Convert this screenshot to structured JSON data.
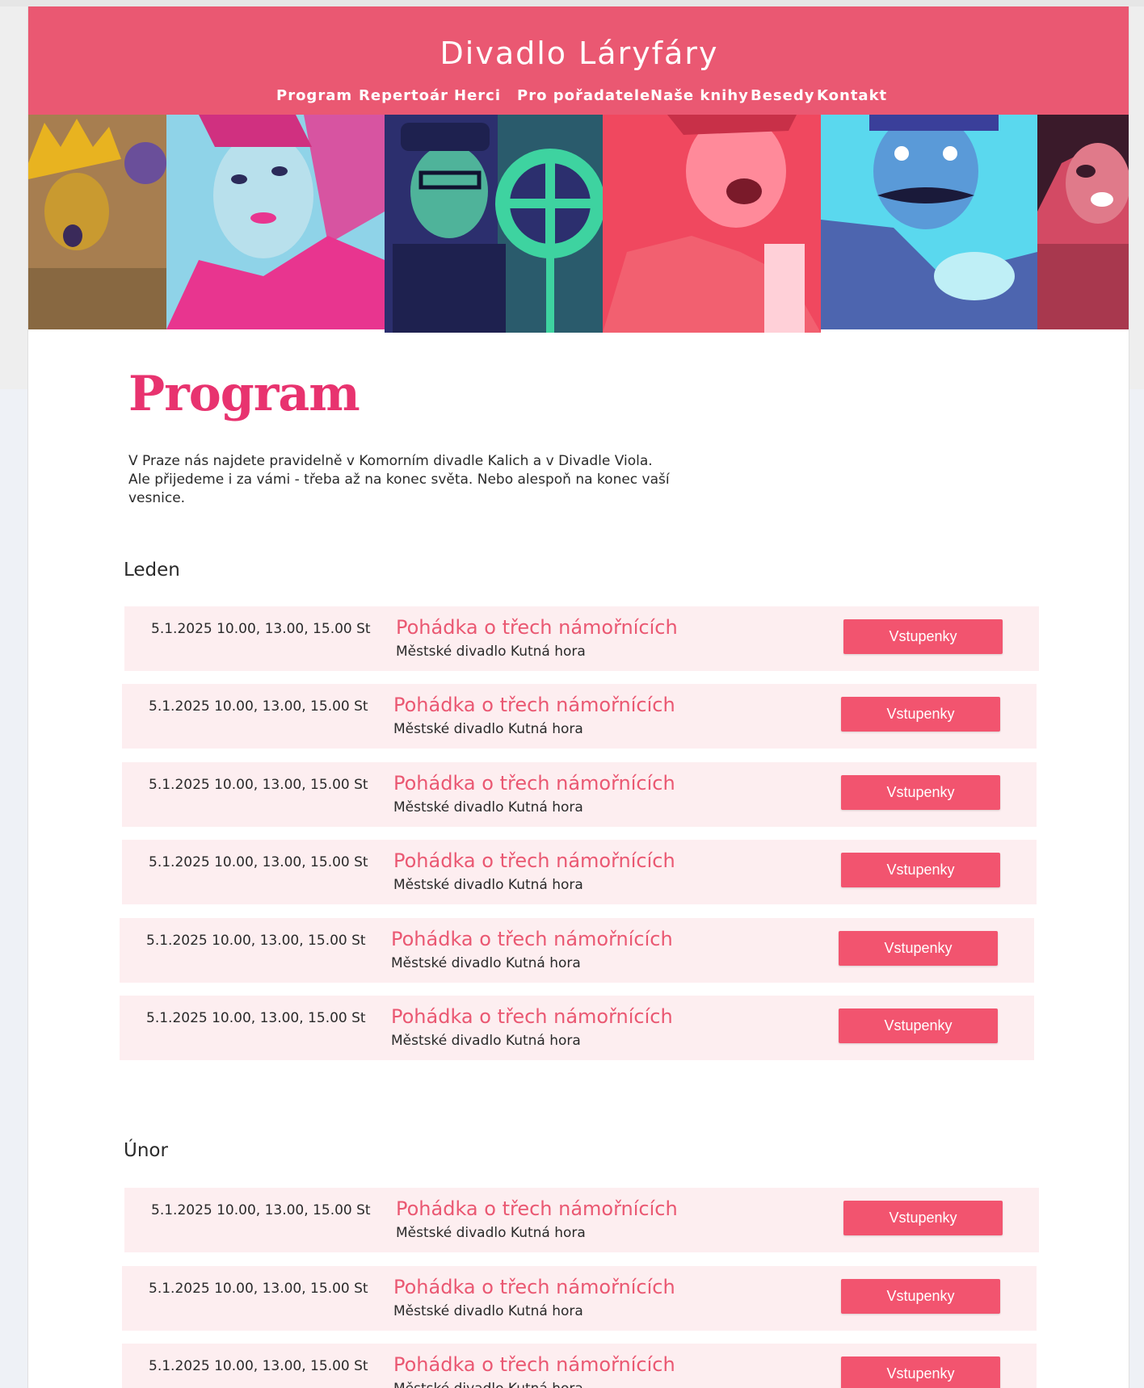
{
  "site": {
    "title": "Divadlo Láryfáry"
  },
  "nav": {
    "items": [
      {
        "label": "Program"
      },
      {
        "label": "Repertoár"
      },
      {
        "label": "Herci"
      },
      {
        "label": "Pro pořadatele"
      },
      {
        "label": "Naše knihy"
      },
      {
        "label": "Besedy"
      },
      {
        "label": "Kontakt"
      }
    ]
  },
  "colors": {
    "header": "#ea5872",
    "accent": "#e8336f",
    "row_background": "#fdeef0",
    "button": "#f2546f"
  },
  "banner": {
    "photos": [
      {
        "tint": "#e8b320",
        "shade": "#5a3f8a",
        "subject": "native-costume-actress"
      },
      {
        "tint": "#e8358f",
        "shade": "#8fd3e8",
        "subject": "clown-makeup-actress"
      },
      {
        "tint": "#3ed3a0",
        "shade": "#2c2f6e",
        "subject": "conductor-with-whistle"
      },
      {
        "tint": "#f0485f",
        "shade": "#ffb0ba",
        "subject": "laughing-actress"
      },
      {
        "tint": "#5ad8ee",
        "shade": "#4a3f9a",
        "subject": "mustached-actor"
      },
      {
        "tint": "#d34a64",
        "shade": "#3a1a2a",
        "subject": "witch-actress"
      }
    ]
  },
  "page": {
    "heading": "Program",
    "intro": "V Praze nás najdete pravidelně v Komorním divadle Kalich a v Divadle Viola. Ale přijedeme i za vámi - třeba až na konec světa. Nebo alespoň na konec vaší vesnice."
  },
  "months": [
    {
      "name": "Leden",
      "events": [
        {
          "date": "5.1.2025 10.00, 13.00, 15.00 St",
          "title": "Pohádka o třech námořnících",
          "venue": "Městské divadlo Kutná hora",
          "button": "Vstupenky"
        },
        {
          "date": "5.1.2025 10.00, 13.00, 15.00 St",
          "title": "Pohádka o třech námořnících",
          "venue": "Městské divadlo Kutná hora",
          "button": "Vstupenky"
        },
        {
          "date": "5.1.2025 10.00, 13.00, 15.00 St",
          "title": "Pohádka o třech námořnících",
          "venue": "Městské divadlo Kutná hora",
          "button": "Vstupenky"
        },
        {
          "date": "5.1.2025 10.00, 13.00, 15.00 St",
          "title": "Pohádka o třech námořnících",
          "venue": "Městské divadlo Kutná hora",
          "button": "Vstupenky"
        },
        {
          "date": "5.1.2025 10.00, 13.00, 15.00 St",
          "title": "Pohádka o třech námořnících",
          "venue": "Městské divadlo Kutná hora",
          "button": "Vstupenky"
        },
        {
          "date": "5.1.2025 10.00, 13.00, 15.00 St",
          "title": "Pohádka o třech námořnících",
          "venue": "Městské divadlo Kutná hora",
          "button": "Vstupenky"
        }
      ]
    },
    {
      "name": "Únor",
      "events": [
        {
          "date": "5.1.2025 10.00, 13.00, 15.00 St",
          "title": "Pohádka o třech námořnících",
          "venue": "Městské divadlo Kutná hora",
          "button": "Vstupenky"
        },
        {
          "date": "5.1.2025 10.00, 13.00, 15.00 St",
          "title": "Pohádka o třech námořnících",
          "venue": "Městské divadlo Kutná hora",
          "button": "Vstupenky"
        },
        {
          "date": "5.1.2025 10.00, 13.00, 15.00 St",
          "title": "Pohádka o třech námořnících",
          "venue": "Městské divadlo Kutná hora",
          "button": "Vstupenky"
        }
      ]
    }
  ]
}
